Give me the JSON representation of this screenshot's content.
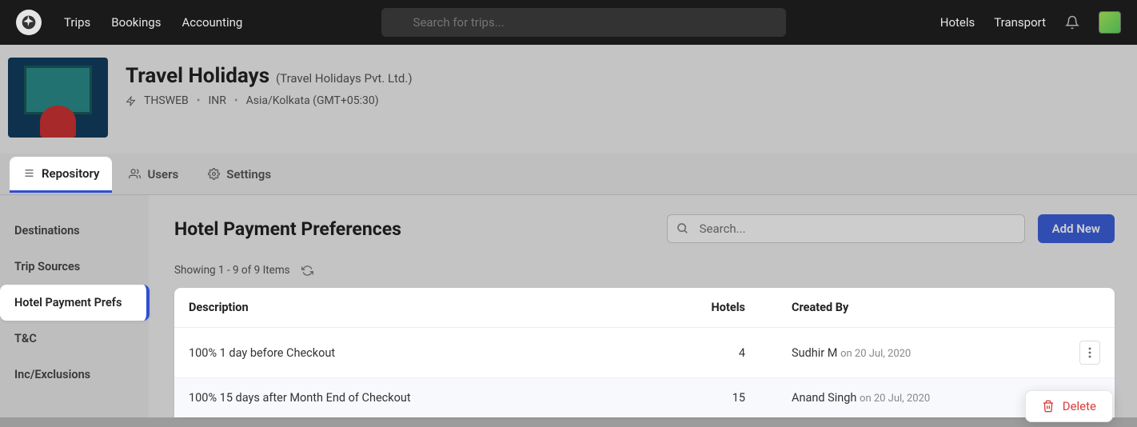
{
  "nav": {
    "primary": [
      "Trips",
      "Bookings",
      "Accounting"
    ],
    "search_placeholder": "Search for trips...",
    "secondary": [
      "Hotels",
      "Transport"
    ]
  },
  "tenant": {
    "name": "Travel Holidays",
    "legal": "(Travel Holidays Pvt. Ltd.)",
    "code": "THSWEB",
    "currency": "INR",
    "timezone": "Asia/Kolkata (GMT+05:30)"
  },
  "tabs": [
    {
      "label": "Repository",
      "active": true
    },
    {
      "label": "Users",
      "active": false
    },
    {
      "label": "Settings",
      "active": false
    }
  ],
  "sidebar": {
    "items": [
      {
        "label": "Destinations",
        "active": false
      },
      {
        "label": "Trip Sources",
        "active": false
      },
      {
        "label": "Hotel Payment Prefs",
        "active": true
      },
      {
        "label": "T&C",
        "active": false
      },
      {
        "label": "Inc/Exclusions",
        "active": false
      }
    ]
  },
  "page": {
    "title": "Hotel Payment Preferences",
    "filter_placeholder": "Search...",
    "add_button": "Add New",
    "showing": "Showing 1 - 9 of 9 Items"
  },
  "table": {
    "headers": [
      "Description",
      "Hotels",
      "Created By"
    ],
    "rows": [
      {
        "description": "100% 1 day before Checkout",
        "hotels": "4",
        "creator": "Sudhir M",
        "date": "on 20 Jul, 2020"
      },
      {
        "description": "100% 15 days after Month End of Checkout",
        "hotels": "15",
        "creator": "Anand Singh",
        "date": "on 20 Jul, 2020"
      }
    ]
  },
  "dropdown": {
    "delete": "Delete"
  }
}
